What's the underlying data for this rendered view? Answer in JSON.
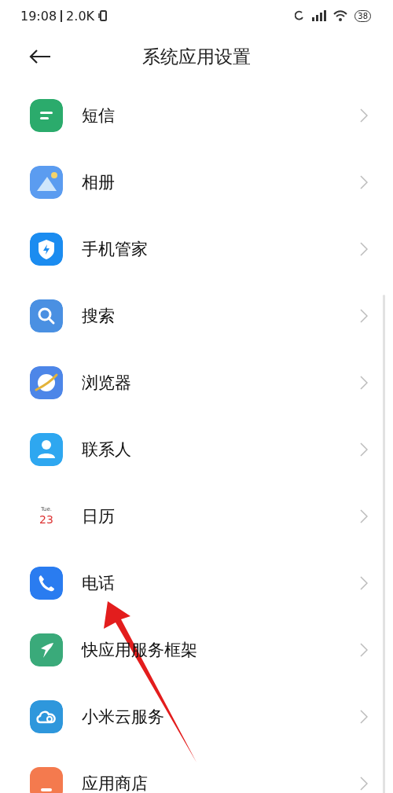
{
  "status_bar": {
    "time": "19:08",
    "speed": "2.0K",
    "battery": "38"
  },
  "header": {
    "title": "系统应用设置"
  },
  "items": [
    {
      "label": "短信",
      "icon": {
        "kind": "message",
        "color": "#2bab6c"
      }
    },
    {
      "label": "相册",
      "icon": {
        "kind": "gallery",
        "color": "#5b9cf0"
      }
    },
    {
      "label": "手机管家",
      "icon": {
        "kind": "shield",
        "color": "#1b8cf0"
      }
    },
    {
      "label": "搜索",
      "icon": {
        "kind": "search",
        "color": "#4a90e2"
      }
    },
    {
      "label": "浏览器",
      "icon": {
        "kind": "planet",
        "color": "#4d86e8"
      }
    },
    {
      "label": "联系人",
      "icon": {
        "kind": "person",
        "color": "#2ea7f0"
      }
    },
    {
      "label": "日历",
      "icon": {
        "kind": "calendar",
        "day": "Tue.",
        "date": "23"
      }
    },
    {
      "label": "电话",
      "icon": {
        "kind": "phone",
        "color": "#2a7cf0"
      }
    },
    {
      "label": "快应用服务框架",
      "icon": {
        "kind": "bird",
        "color": "#3aaa7a"
      }
    },
    {
      "label": "小米云服务",
      "icon": {
        "kind": "cloud",
        "color": "#2e97dc"
      }
    },
    {
      "label": "应用商店",
      "icon": {
        "kind": "store",
        "color": "#f47a4e"
      }
    }
  ]
}
